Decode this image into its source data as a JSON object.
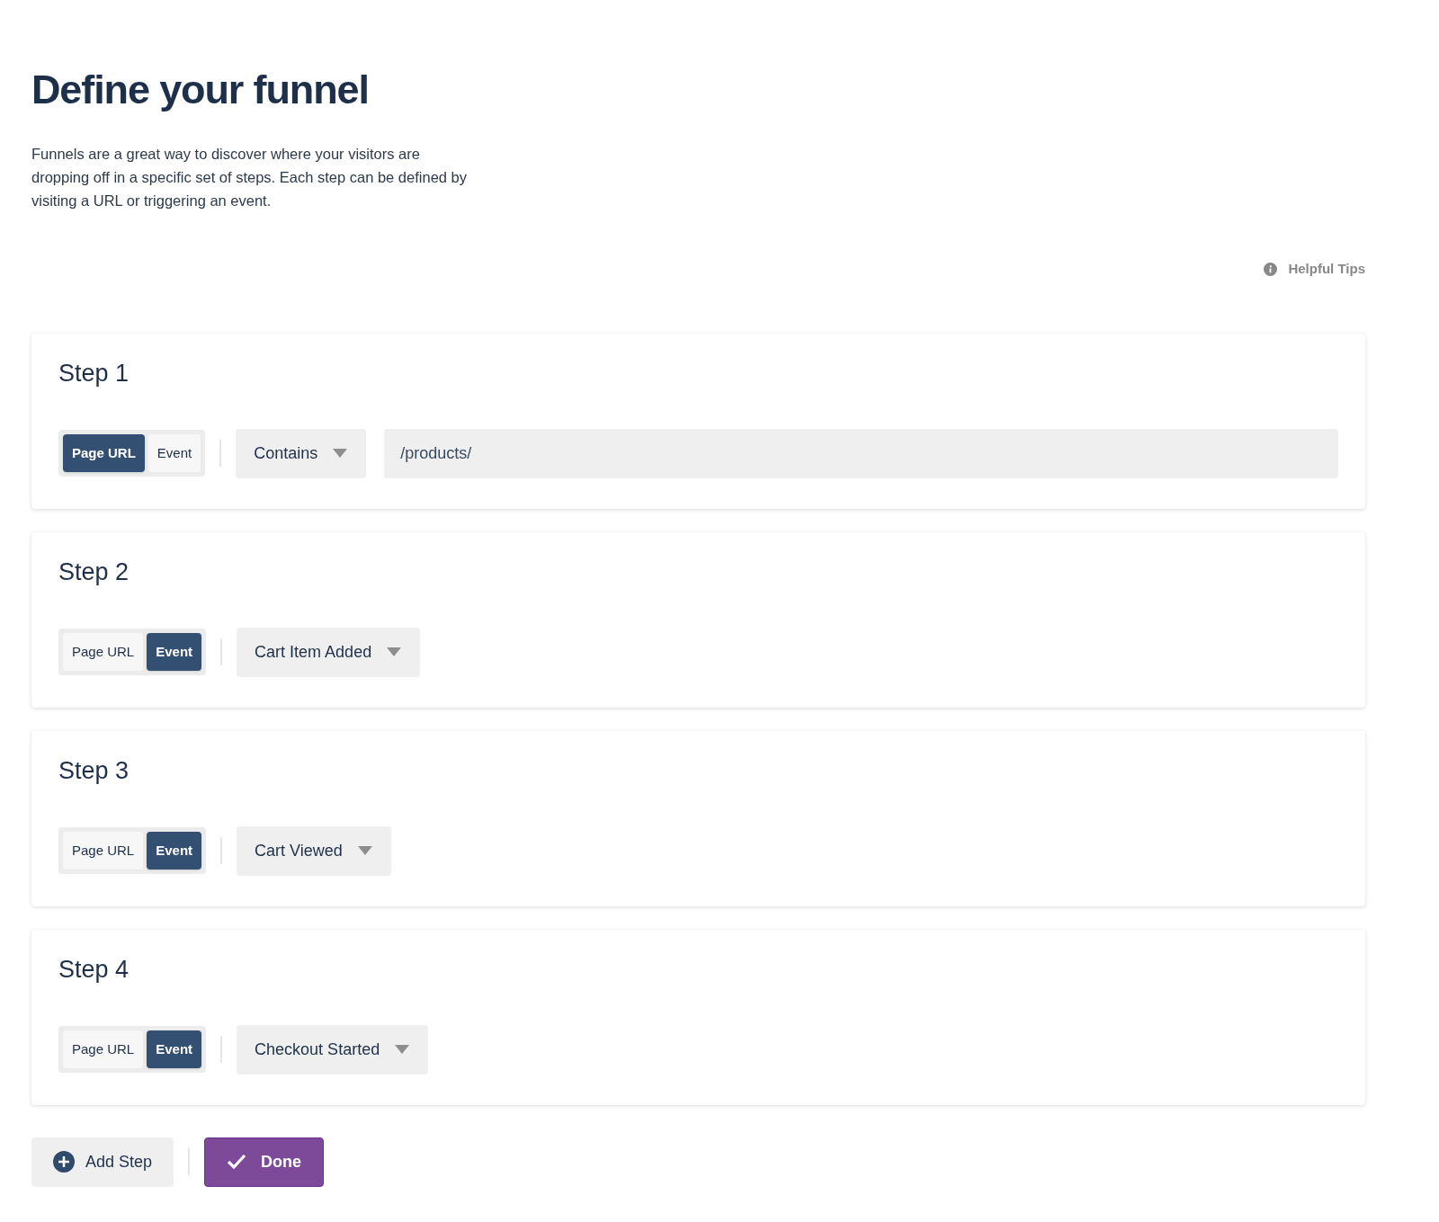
{
  "page": {
    "title": "Define your funnel",
    "description": "Funnels are a great way to discover where your visitors are dropping off in a specific set of steps. Each step can be defined by visiting a URL or triggering an event.",
    "help_link": "Helpful Tips"
  },
  "steps": [
    {
      "title": "Step 1",
      "source": [
        {
          "label": "Page URL",
          "selected": true
        },
        {
          "label": "Event",
          "selected": false
        }
      ],
      "dropdown": "Contains",
      "field_value": "/products/"
    },
    {
      "title": "Step 2",
      "source": [
        {
          "label": "Page URL",
          "selected": false
        },
        {
          "label": "Event",
          "selected": true
        }
      ],
      "dropdown": "Cart Item Added"
    },
    {
      "title": "Step 3",
      "source": [
        {
          "label": "Page URL",
          "selected": false
        },
        {
          "label": "Event",
          "selected": true
        }
      ],
      "dropdown": "Cart Viewed"
    },
    {
      "title": "Step 4",
      "source": [
        {
          "label": "Page URL",
          "selected": false
        },
        {
          "label": "Event",
          "selected": true
        }
      ],
      "dropdown": "Checkout Started"
    }
  ],
  "actions": {
    "add": "Add Step",
    "done": "Done"
  }
}
